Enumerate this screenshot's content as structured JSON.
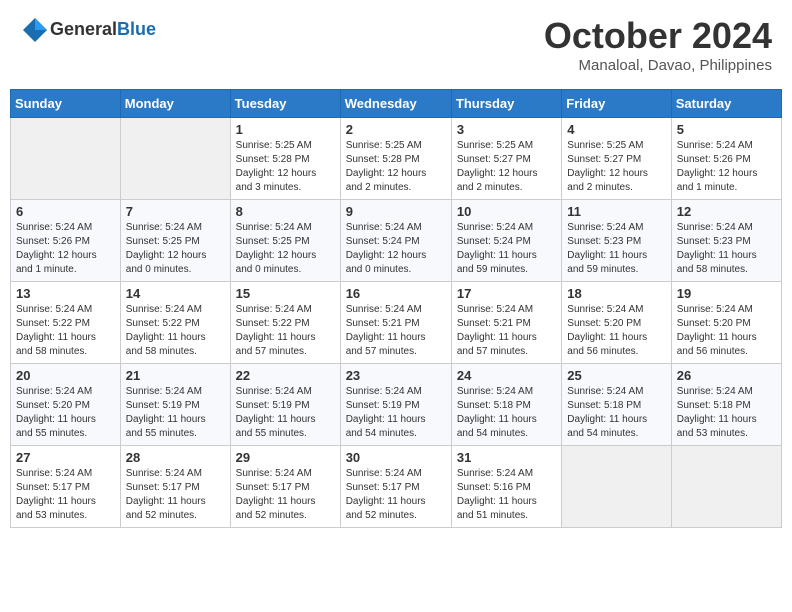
{
  "header": {
    "logo_general": "General",
    "logo_blue": "Blue",
    "month_title": "October 2024",
    "location": "Manaloal, Davao, Philippines"
  },
  "calendar": {
    "days_of_week": [
      "Sunday",
      "Monday",
      "Tuesday",
      "Wednesday",
      "Thursday",
      "Friday",
      "Saturday"
    ],
    "weeks": [
      [
        {
          "day": "",
          "info": ""
        },
        {
          "day": "",
          "info": ""
        },
        {
          "day": "1",
          "info": "Sunrise: 5:25 AM\nSunset: 5:28 PM\nDaylight: 12 hours\nand 3 minutes."
        },
        {
          "day": "2",
          "info": "Sunrise: 5:25 AM\nSunset: 5:28 PM\nDaylight: 12 hours\nand 2 minutes."
        },
        {
          "day": "3",
          "info": "Sunrise: 5:25 AM\nSunset: 5:27 PM\nDaylight: 12 hours\nand 2 minutes."
        },
        {
          "day": "4",
          "info": "Sunrise: 5:25 AM\nSunset: 5:27 PM\nDaylight: 12 hours\nand 2 minutes."
        },
        {
          "day": "5",
          "info": "Sunrise: 5:24 AM\nSunset: 5:26 PM\nDaylight: 12 hours\nand 1 minute."
        }
      ],
      [
        {
          "day": "6",
          "info": "Sunrise: 5:24 AM\nSunset: 5:26 PM\nDaylight: 12 hours\nand 1 minute."
        },
        {
          "day": "7",
          "info": "Sunrise: 5:24 AM\nSunset: 5:25 PM\nDaylight: 12 hours\nand 0 minutes."
        },
        {
          "day": "8",
          "info": "Sunrise: 5:24 AM\nSunset: 5:25 PM\nDaylight: 12 hours\nand 0 minutes."
        },
        {
          "day": "9",
          "info": "Sunrise: 5:24 AM\nSunset: 5:24 PM\nDaylight: 12 hours\nand 0 minutes."
        },
        {
          "day": "10",
          "info": "Sunrise: 5:24 AM\nSunset: 5:24 PM\nDaylight: 11 hours\nand 59 minutes."
        },
        {
          "day": "11",
          "info": "Sunrise: 5:24 AM\nSunset: 5:23 PM\nDaylight: 11 hours\nand 59 minutes."
        },
        {
          "day": "12",
          "info": "Sunrise: 5:24 AM\nSunset: 5:23 PM\nDaylight: 11 hours\nand 58 minutes."
        }
      ],
      [
        {
          "day": "13",
          "info": "Sunrise: 5:24 AM\nSunset: 5:22 PM\nDaylight: 11 hours\nand 58 minutes."
        },
        {
          "day": "14",
          "info": "Sunrise: 5:24 AM\nSunset: 5:22 PM\nDaylight: 11 hours\nand 58 minutes."
        },
        {
          "day": "15",
          "info": "Sunrise: 5:24 AM\nSunset: 5:22 PM\nDaylight: 11 hours\nand 57 minutes."
        },
        {
          "day": "16",
          "info": "Sunrise: 5:24 AM\nSunset: 5:21 PM\nDaylight: 11 hours\nand 57 minutes."
        },
        {
          "day": "17",
          "info": "Sunrise: 5:24 AM\nSunset: 5:21 PM\nDaylight: 11 hours\nand 57 minutes."
        },
        {
          "day": "18",
          "info": "Sunrise: 5:24 AM\nSunset: 5:20 PM\nDaylight: 11 hours\nand 56 minutes."
        },
        {
          "day": "19",
          "info": "Sunrise: 5:24 AM\nSunset: 5:20 PM\nDaylight: 11 hours\nand 56 minutes."
        }
      ],
      [
        {
          "day": "20",
          "info": "Sunrise: 5:24 AM\nSunset: 5:20 PM\nDaylight: 11 hours\nand 55 minutes."
        },
        {
          "day": "21",
          "info": "Sunrise: 5:24 AM\nSunset: 5:19 PM\nDaylight: 11 hours\nand 55 minutes."
        },
        {
          "day": "22",
          "info": "Sunrise: 5:24 AM\nSunset: 5:19 PM\nDaylight: 11 hours\nand 55 minutes."
        },
        {
          "day": "23",
          "info": "Sunrise: 5:24 AM\nSunset: 5:19 PM\nDaylight: 11 hours\nand 54 minutes."
        },
        {
          "day": "24",
          "info": "Sunrise: 5:24 AM\nSunset: 5:18 PM\nDaylight: 11 hours\nand 54 minutes."
        },
        {
          "day": "25",
          "info": "Sunrise: 5:24 AM\nSunset: 5:18 PM\nDaylight: 11 hours\nand 54 minutes."
        },
        {
          "day": "26",
          "info": "Sunrise: 5:24 AM\nSunset: 5:18 PM\nDaylight: 11 hours\nand 53 minutes."
        }
      ],
      [
        {
          "day": "27",
          "info": "Sunrise: 5:24 AM\nSunset: 5:17 PM\nDaylight: 11 hours\nand 53 minutes."
        },
        {
          "day": "28",
          "info": "Sunrise: 5:24 AM\nSunset: 5:17 PM\nDaylight: 11 hours\nand 52 minutes."
        },
        {
          "day": "29",
          "info": "Sunrise: 5:24 AM\nSunset: 5:17 PM\nDaylight: 11 hours\nand 52 minutes."
        },
        {
          "day": "30",
          "info": "Sunrise: 5:24 AM\nSunset: 5:17 PM\nDaylight: 11 hours\nand 52 minutes."
        },
        {
          "day": "31",
          "info": "Sunrise: 5:24 AM\nSunset: 5:16 PM\nDaylight: 11 hours\nand 51 minutes."
        },
        {
          "day": "",
          "info": ""
        },
        {
          "day": "",
          "info": ""
        }
      ]
    ]
  }
}
